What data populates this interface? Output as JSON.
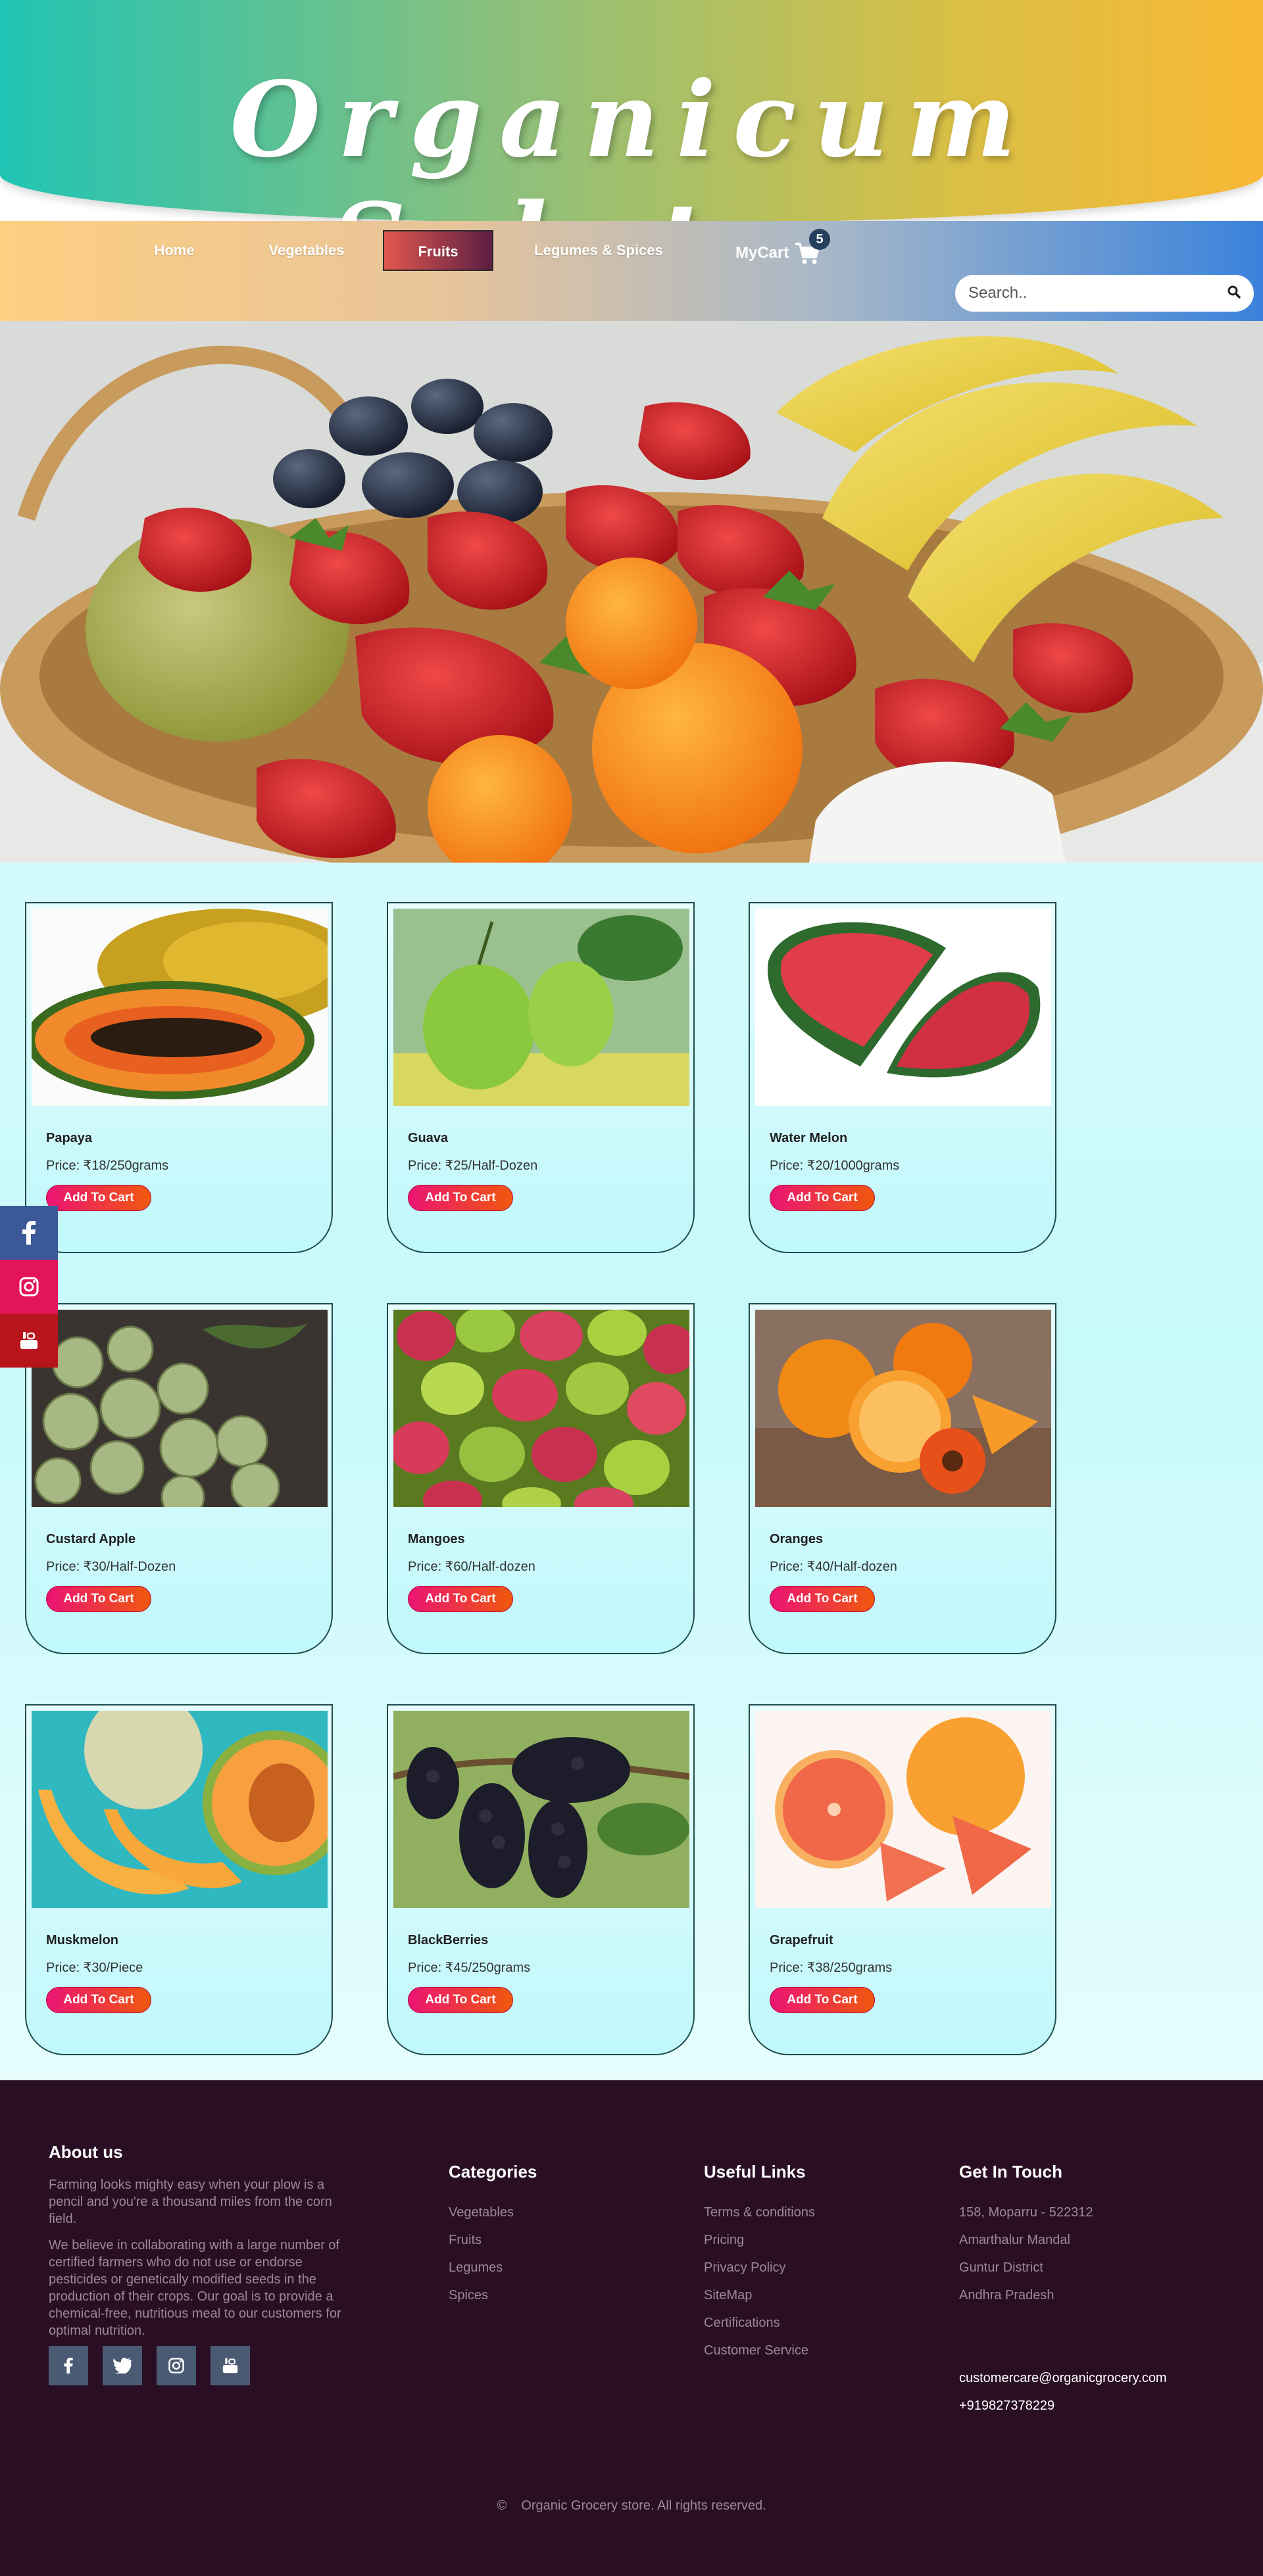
{
  "site": {
    "title": "Organicum Salutem"
  },
  "nav": {
    "items": [
      "Home",
      "Vegetables",
      "Fruits",
      "Legumes & Spices"
    ],
    "active": "Fruits",
    "cart_label": "MyCart",
    "cart_count": "5"
  },
  "search": {
    "placeholder": "Search.."
  },
  "products": [
    {
      "name": "Papaya",
      "price": "Price: ₹18/250grams",
      "button": "Add To Cart"
    },
    {
      "name": "Guava",
      "price": "Price: ₹25/Half-Dozen",
      "button": "Add To Cart"
    },
    {
      "name": "Water Melon",
      "price": "Price: ₹20/1000grams",
      "button": "Add To Cart"
    },
    {
      "name": "Custard Apple",
      "price": "Price: ₹30/Half-Dozen",
      "button": "Add To Cart"
    },
    {
      "name": "Mangoes",
      "price": "Price: ₹60/Half-dozen",
      "button": "Add To Cart"
    },
    {
      "name": "Oranges",
      "price": "Price: ₹40/Half-dozen",
      "button": "Add To Cart"
    },
    {
      "name": "Muskmelon",
      "price": "Price: ₹30/Piece",
      "button": "Add To Cart"
    },
    {
      "name": "BlackBerries",
      "price": "Price: ₹45/250grams",
      "button": "Add To Cart"
    },
    {
      "name": "Grapefruit",
      "price": "Price: ₹38/250grams",
      "button": "Add To Cart"
    }
  ],
  "side_social": [
    "facebook-icon",
    "instagram-icon",
    "youtube-icon"
  ],
  "footer": {
    "about": {
      "title": "About us",
      "p1": "Farming looks mighty easy when your plow is a pencil and you're a thousand miles from the corn field.",
      "p2": "We believe in collaborating with a large number of certified farmers who do not use or endorse pesticides or genetically modified seeds in the production of their crops. Our goal is to provide a chemical-free, nutritious meal to our customers for optimal nutrition."
    },
    "categories": {
      "title": "Categories",
      "items": [
        "Vegetables",
        "Fruits",
        "Legumes",
        "Spices"
      ]
    },
    "useful_links": {
      "title": "Useful Links",
      "items": [
        "Terms & conditions",
        "Pricing",
        "Privacy Policy",
        "SiteMap",
        "Certifications",
        "Customer Service"
      ]
    },
    "contact": {
      "title": "Get In Touch",
      "address": [
        "158, Moparru - 522312",
        "Amarthalur Mandal",
        "Guntur District",
        "Andhra Pradesh"
      ],
      "email": "customercare@organicgrocery.com",
      "phone": "+919827378229"
    },
    "social": [
      "facebook-icon",
      "twitter-icon",
      "instagram-icon",
      "youtube-icon"
    ],
    "copyright_symbol": "©",
    "copyright": "Organic Grocery store. All rights reserved."
  },
  "colors": {
    "accent": "#ec1474",
    "footer_bg": "#2a0f24",
    "nav_active": "#5c1e44"
  }
}
